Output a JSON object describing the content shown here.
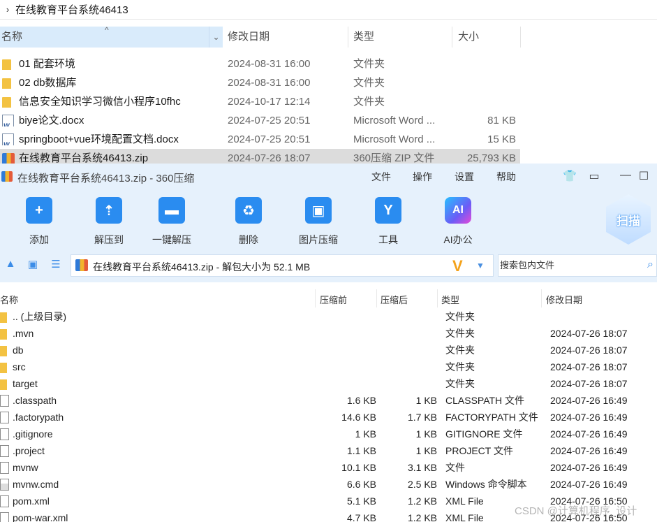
{
  "explorer": {
    "breadcrumb": "在线教育平台系统46413",
    "headers": {
      "name": "名称",
      "date": "修改日期",
      "type": "类型",
      "size": "大小"
    },
    "rows": [
      {
        "icon": "folder-icon",
        "name": "01 配套环境",
        "date": "2024-08-31 16:00",
        "type": "文件夹",
        "size": ""
      },
      {
        "icon": "folder-icon",
        "name": "02 db数据库",
        "date": "2024-08-31 16:00",
        "type": "文件夹",
        "size": ""
      },
      {
        "icon": "folder-icon",
        "name": "信息安全知识学习微信小程序10fhc",
        "date": "2024-10-17 12:14",
        "type": "文件夹",
        "size": ""
      },
      {
        "icon": "word-doc-icon",
        "name": "biye论文.docx",
        "date": "2024-07-25 20:51",
        "type": "Microsoft Word ...",
        "size": "81 KB"
      },
      {
        "icon": "word-doc-icon",
        "name": "springboot+vue环境配置文档.docx",
        "date": "2024-07-25 20:51",
        "type": "Microsoft Word ...",
        "size": "15 KB"
      },
      {
        "icon": "zip-icon",
        "name": "在线教育平台系统46413.zip",
        "date": "2024-07-26 18:07",
        "type": "360压缩 ZIP 文件",
        "size": "25,793 KB",
        "selected": true
      }
    ]
  },
  "zipwin": {
    "title": "在线教育平台系统46413.zip - 360压缩",
    "menu": [
      "文件",
      "操作",
      "设置",
      "帮助"
    ],
    "toolbar": [
      {
        "label": "添加",
        "icon": "add-icon",
        "glyph": "+"
      },
      {
        "label": "解压到",
        "icon": "extract-to-icon",
        "glyph": "⇡"
      },
      {
        "label": "一键解压",
        "icon": "one-click-extract-icon",
        "glyph": "▬"
      },
      {
        "label": "删除",
        "icon": "recycle-delete-icon",
        "glyph": "♻"
      },
      {
        "label": "图片压缩",
        "icon": "image-compress-icon",
        "glyph": "▣"
      },
      {
        "label": "工具",
        "icon": "tools-icon",
        "glyph": "Y"
      },
      {
        "label": "AI办公",
        "icon": "ai-office-icon",
        "glyph": "AI"
      }
    ],
    "scan_label": "扫描",
    "address": "在线教育平台系统46413.zip - 解包大小为 52.1 MB",
    "search_placeholder": "搜索包内文件",
    "headers": {
      "name": "名称",
      "before": "压缩前",
      "after": "压缩后",
      "type": "类型",
      "date": "修改日期"
    },
    "rows": [
      {
        "icon": "folder-icon",
        "name": ".. (上级目录)",
        "before": "",
        "after": "",
        "type": "文件夹",
        "date": ""
      },
      {
        "icon": "folder-icon",
        "name": ".mvn",
        "before": "",
        "after": "",
        "type": "文件夹",
        "date": "2024-07-26 18:07"
      },
      {
        "icon": "folder-icon",
        "name": "db",
        "before": "",
        "after": "",
        "type": "文件夹",
        "date": "2024-07-26 18:07"
      },
      {
        "icon": "folder-icon",
        "name": "src",
        "before": "",
        "after": "",
        "type": "文件夹",
        "date": "2024-07-26 18:07"
      },
      {
        "icon": "folder-icon",
        "name": "target",
        "before": "",
        "after": "",
        "type": "文件夹",
        "date": "2024-07-26 18:07"
      },
      {
        "icon": "file-icon",
        "name": ".classpath",
        "before": "1.6 KB",
        "after": "1 KB",
        "type": "CLASSPATH 文件",
        "date": "2024-07-26 16:49"
      },
      {
        "icon": "file-icon",
        "name": ".factorypath",
        "before": "14.6 KB",
        "after": "1.7 KB",
        "type": "FACTORYPATH 文件",
        "date": "2024-07-26 16:49"
      },
      {
        "icon": "file-icon",
        "name": ".gitignore",
        "before": "1 KB",
        "after": "1 KB",
        "type": "GITIGNORE 文件",
        "date": "2024-07-26 16:49"
      },
      {
        "icon": "file-icon",
        "name": ".project",
        "before": "1.1 KB",
        "after": "1 KB",
        "type": "PROJECT 文件",
        "date": "2024-07-26 16:49"
      },
      {
        "icon": "file-icon",
        "name": "mvnw",
        "before": "10.1 KB",
        "after": "3.1 KB",
        "type": "文件",
        "date": "2024-07-26 16:49"
      },
      {
        "icon": "cmd-script-icon",
        "name": "mvnw.cmd",
        "before": "6.6 KB",
        "after": "2.5 KB",
        "type": "Windows 命令脚本",
        "date": "2024-07-26 16:49"
      },
      {
        "icon": "file-icon",
        "name": "pom.xml",
        "before": "5.1 KB",
        "after": "1.2 KB",
        "type": "XML File",
        "date": "2024-07-26 16:50"
      },
      {
        "icon": "file-icon",
        "name": "pom-war.xml",
        "before": "4.7 KB",
        "after": "1.2 KB",
        "type": "XML File",
        "date": "2024-07-26 16:50"
      }
    ]
  },
  "watermark": "CSDN @计算机程序_设计"
}
